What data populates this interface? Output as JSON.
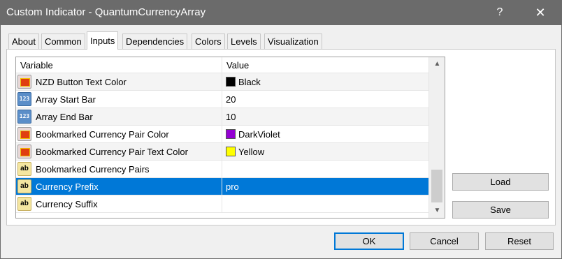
{
  "window": {
    "title": "Custom Indicator - QuantumCurrencyArray",
    "help_label": "?",
    "close_label": "✕"
  },
  "tabs": [
    {
      "label": "About"
    },
    {
      "label": "Common"
    },
    {
      "label": "Inputs",
      "active": true
    },
    {
      "label": "Dependencies"
    },
    {
      "label": "Colors"
    },
    {
      "label": "Levels"
    },
    {
      "label": "Visualization"
    }
  ],
  "grid": {
    "headers": {
      "variable": "Variable",
      "value": "Value"
    },
    "rows": [
      {
        "icon": "color-icon",
        "name": "NZD Button Text Color",
        "value": "Black",
        "swatch": "#000000"
      },
      {
        "icon": "number-icon",
        "name": "Array Start Bar",
        "value": "20"
      },
      {
        "icon": "number-icon",
        "name": "Array End Bar",
        "value": "10"
      },
      {
        "icon": "color-icon",
        "name": "Bookmarked Currency Pair Color",
        "value": "DarkViolet",
        "swatch": "#9400d3"
      },
      {
        "icon": "color-icon",
        "name": "Bookmarked Currency Pair Text Color",
        "value": "Yellow",
        "swatch": "#ffff00"
      },
      {
        "icon": "string-icon",
        "name": "Bookmarked Currency Pairs",
        "value": ""
      },
      {
        "icon": "string-icon",
        "name": "Currency Prefix",
        "value": "pro",
        "selected": true
      },
      {
        "icon": "string-icon",
        "name": "Currency Suffix",
        "value": ""
      }
    ],
    "icon_text": {
      "number": "123",
      "string": "ab"
    }
  },
  "side_buttons": {
    "load": "Load",
    "save": "Save"
  },
  "footer_buttons": {
    "ok": "OK",
    "cancel": "Cancel",
    "reset": "Reset"
  },
  "colors": {
    "titlebar": "#6b6b6b",
    "selection": "#0078d7"
  }
}
